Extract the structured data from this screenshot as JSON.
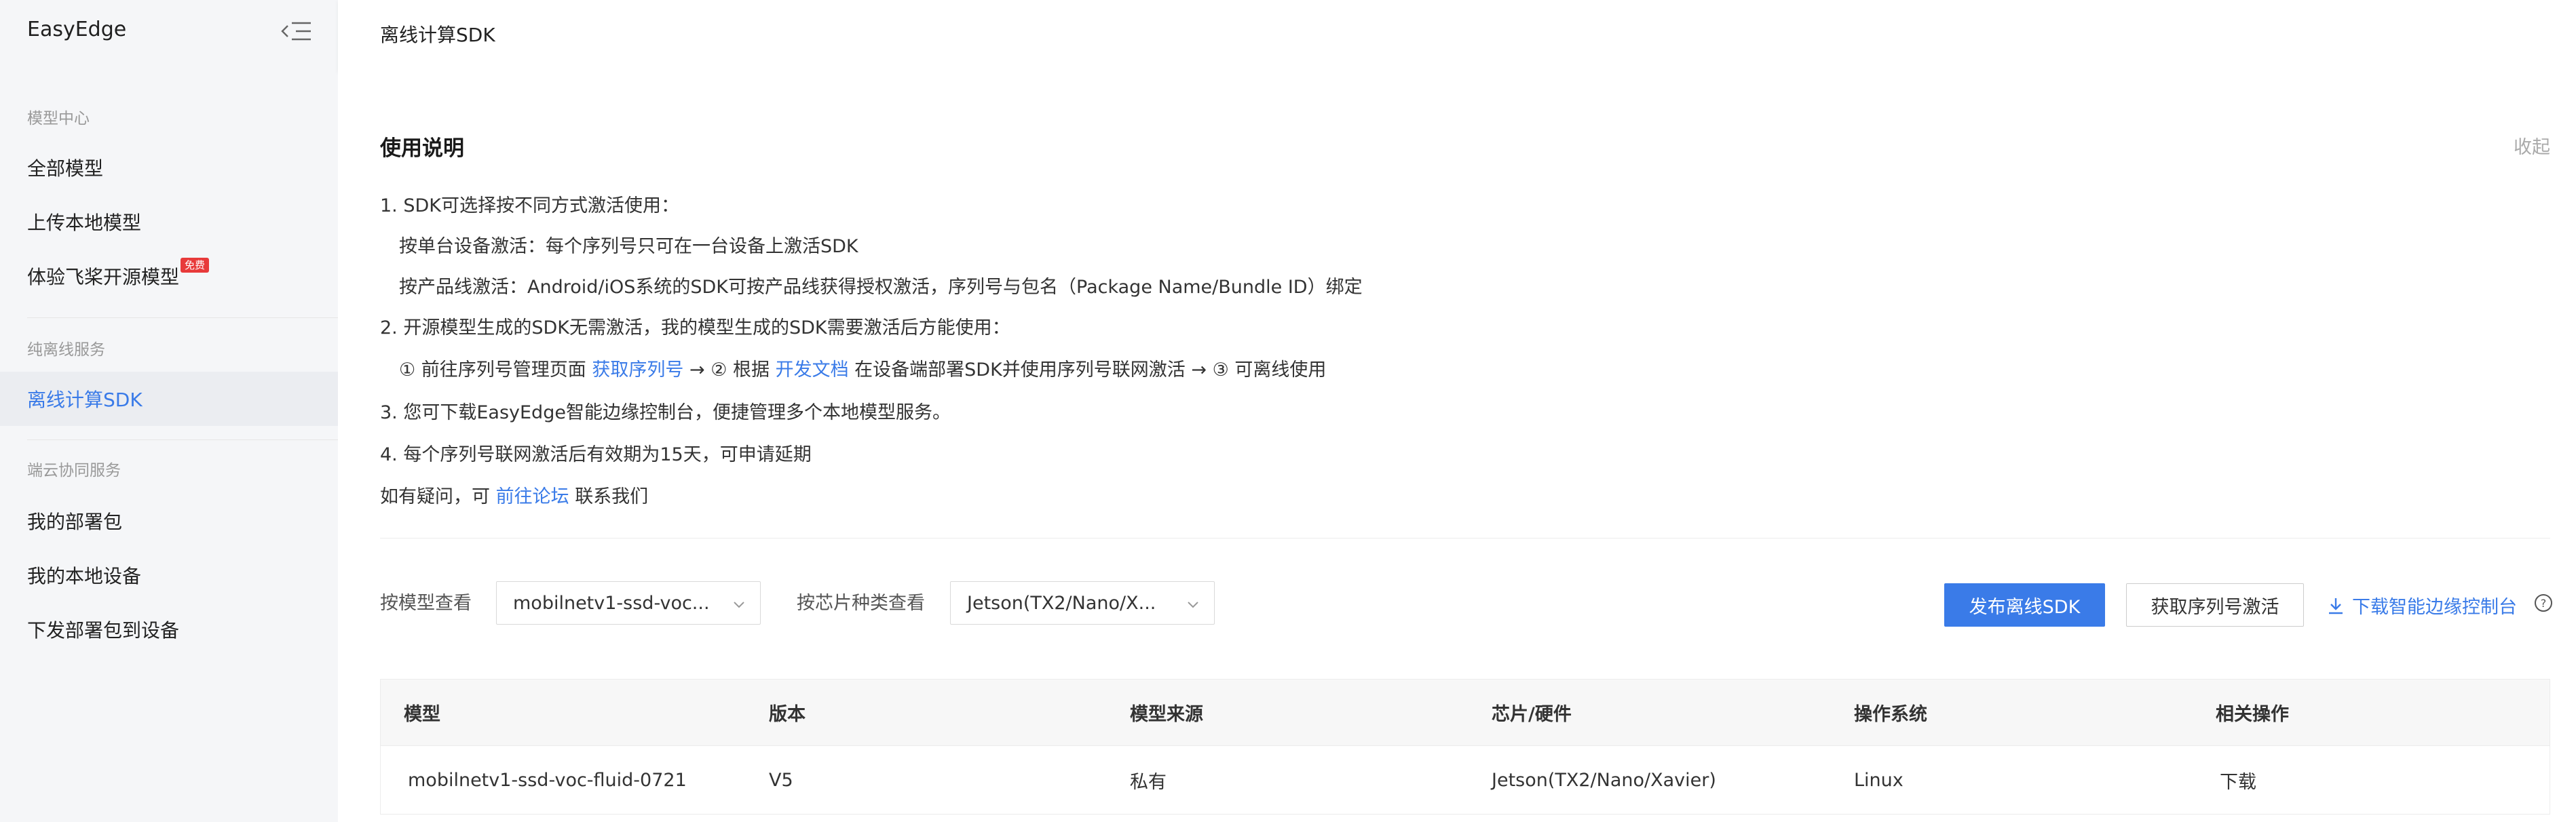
{
  "brand": "EasyEdge",
  "sidebar": {
    "sections": [
      {
        "title": "模型中心",
        "items": [
          {
            "label": "全部模型"
          },
          {
            "label": "上传本地模型"
          },
          {
            "label": "体验飞桨开源模型",
            "badge": "免费"
          }
        ]
      },
      {
        "title": "纯离线服务",
        "items": [
          {
            "label": "离线计算SDK"
          }
        ]
      },
      {
        "title": "端云协同服务",
        "items": [
          {
            "label": "我的部署包"
          },
          {
            "label": "我的本地设备"
          },
          {
            "label": "下发部署包到设备"
          }
        ]
      }
    ]
  },
  "header": {
    "title": "离线计算SDK"
  },
  "instructions": {
    "title": "使用说明",
    "collapse": "收起",
    "l1": "1. SDK可选择按不同方式激活使用：",
    "l1a": "按单台设备激活：每个序列号只可在一台设备上激活SDK",
    "l1b": "按产品线激活：Android/iOS系统的SDK可按产品线获得授权激活，序列号与包名（Package Name/Bundle ID）绑定",
    "l2": "2. 开源模型生成的SDK无需激活，我的模型生成的SDK需要激活后方能使用：",
    "l2a_pre": "① 前往序列号管理页面",
    "l2a_link1": "获取序列号",
    "l2a_mid": "→ ② 根据",
    "l2a_link2": "开发文档",
    "l2a_post": "在设备端部署SDK并使用序列号联网激活 → ③ 可离线使用",
    "l3": "3. 您可下载EasyEdge智能边缘控制台，便捷管理多个本地模型服务。",
    "l4": "4. 每个序列号联网激活后有效期为15天，可申请延期",
    "l5_pre": "如有疑问，可",
    "l5_link": "前往论坛",
    "l5_post": "联系我们"
  },
  "filters": {
    "model_label": "按模型查看",
    "model_value": "mobilnetv1-ssd-voc...",
    "chip_label": "按芯片种类查看",
    "chip_value": "Jetson(TX2/Nano/X..."
  },
  "actions": {
    "publish": "发布离线SDK",
    "activate": "获取序列号激活",
    "download_console": "下载智能边缘控制台"
  },
  "table": {
    "headers": [
      "模型",
      "版本",
      "模型来源",
      "芯片/硬件",
      "操作系统",
      "相关操作"
    ],
    "rows": [
      {
        "model": "mobilnetv1-ssd-voc-fluid-0721",
        "version": "V5",
        "source": "私有",
        "chip": "Jetson(TX2/Nano/Xavier)",
        "os": "Linux",
        "op": "下载"
      }
    ]
  },
  "colors": {
    "accent": "#3a7be8",
    "badge": "#e83a3a"
  }
}
